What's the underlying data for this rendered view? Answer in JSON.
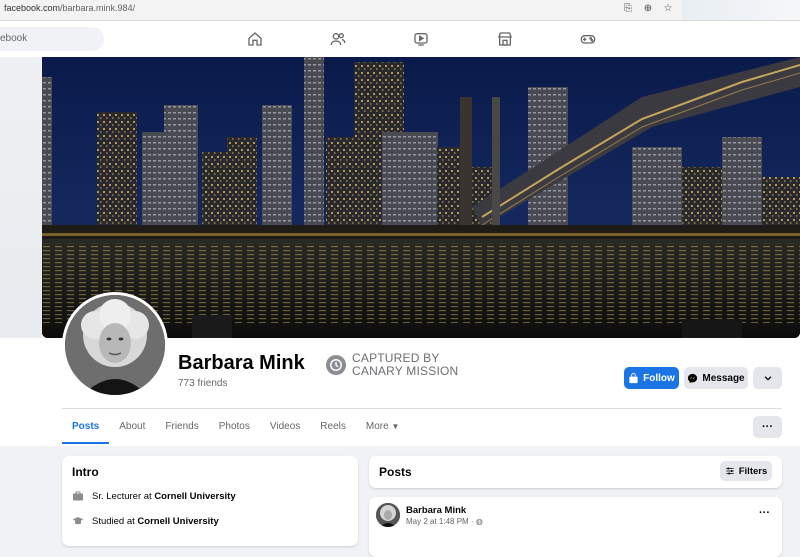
{
  "browser": {
    "url_host": "facebook.com",
    "url_path": "/barbara.mink.984/"
  },
  "topnav": {
    "search_text": "ebook"
  },
  "profile": {
    "name": "Barbara Mink",
    "friends": "773 friends",
    "stamp_line1": "CAPTURED BY",
    "stamp_line2": "CANARY MISSION"
  },
  "actions": {
    "follow": "Follow",
    "message": "Message"
  },
  "tabs": [
    {
      "label": "Posts",
      "active": true
    },
    {
      "label": "About"
    },
    {
      "label": "Friends"
    },
    {
      "label": "Photos"
    },
    {
      "label": "Videos"
    },
    {
      "label": "Reels"
    },
    {
      "label": "More"
    }
  ],
  "intro": {
    "title": "Intro",
    "work_prefix": "Sr. Lecturer at ",
    "work_place": "Cornell University",
    "study_prefix": "Studied at ",
    "study_place": "Cornell University"
  },
  "posts": {
    "title": "Posts",
    "filters": "Filters",
    "first_post": {
      "author": "Barbara Mink",
      "meta": "May 2 at 1:48 PM · "
    }
  },
  "colors": {
    "accent": "#1b74e4",
    "page_bg": "#f0f2f5"
  }
}
